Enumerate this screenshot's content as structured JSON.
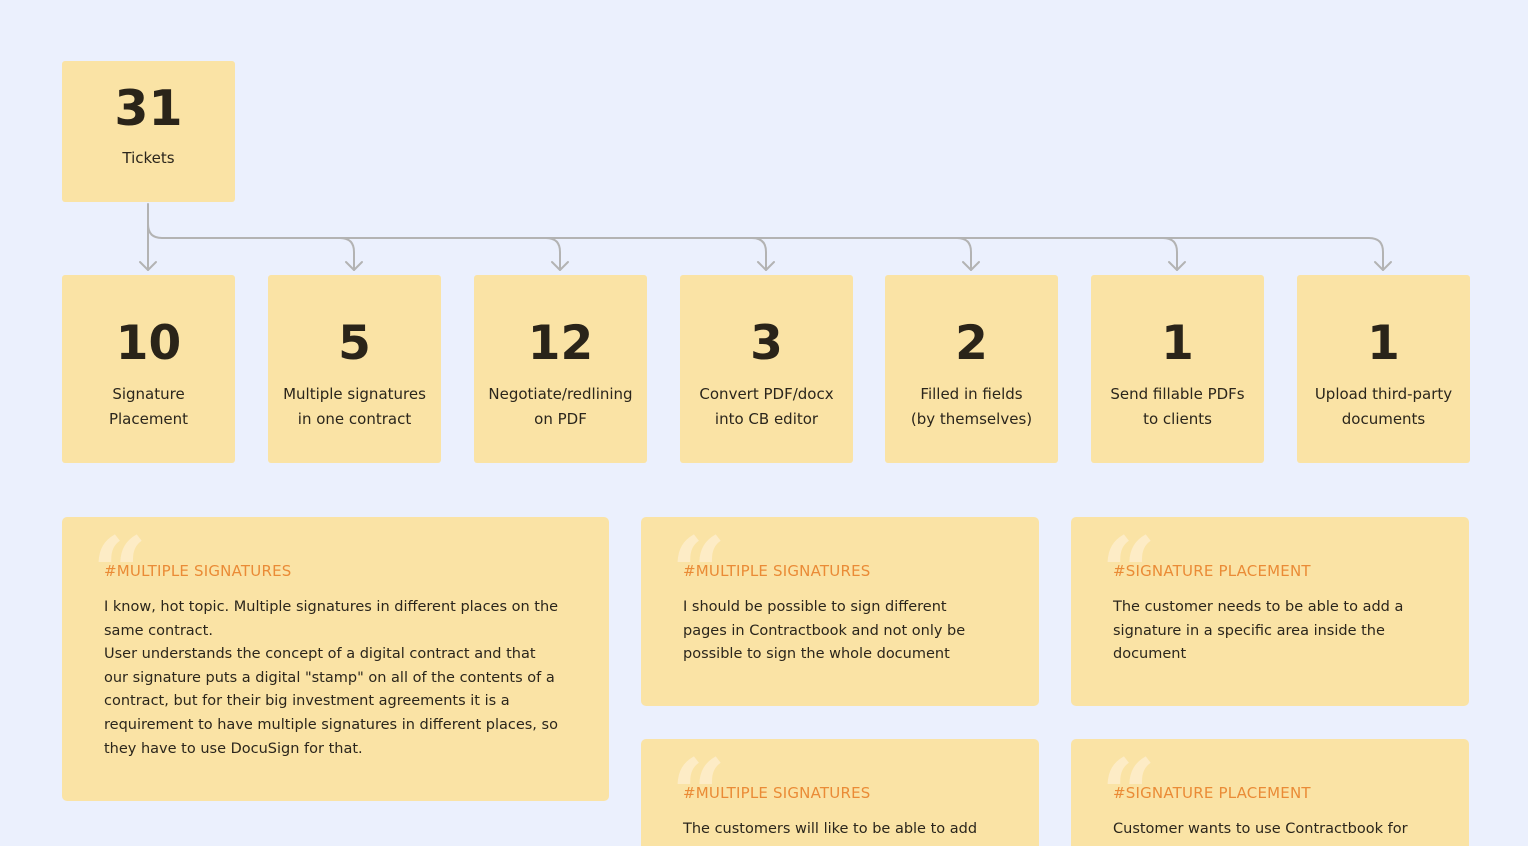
{
  "total": {
    "count": "31",
    "label": "Tickets"
  },
  "categories": [
    {
      "count": "10",
      "label_lines": [
        "Signature",
        "Placement"
      ]
    },
    {
      "count": "5",
      "label_lines": [
        "Multiple signatures",
        "in one contract"
      ]
    },
    {
      "count": "12",
      "label_lines": [
        "Negotiate/redlining",
        "on PDF"
      ]
    },
    {
      "count": "3",
      "label_lines": [
        "Convert PDF/docx",
        "into CB editor"
      ]
    },
    {
      "count": "2",
      "label_lines": [
        "Filled in fields",
        "(by themselves)"
      ]
    },
    {
      "count": "1",
      "label_lines": [
        "Send fillable PDFs",
        "to clients"
      ]
    },
    {
      "count": "1",
      "label_lines": [
        "Upload third-party",
        "documents"
      ]
    }
  ],
  "quotes": [
    {
      "tag": "#MULTIPLE SIGNATURES",
      "lines": [
        "I know, hot topic. Multiple signatures in different places on the",
        "same contract.",
        "User understands the concept of a digital contract and that",
        "our signature puts a digital \"stamp\" on all of the contents of a",
        "contract, but for their big investment agreements it is a",
        "requirement to have multiple signatures in different places, so",
        "they have to use DocuSign for that."
      ]
    },
    {
      "tag": "#MULTIPLE SIGNATURES",
      "lines": [
        "I should be possible to sign different",
        "pages in Contractbook and not only be",
        "possible to sign the whole document"
      ]
    },
    {
      "tag": "#SIGNATURE PLACEMENT",
      "lines": [
        "The customer needs to be able to add a",
        "signature in a specific area inside the",
        "document"
      ]
    },
    {
      "tag": "#MULTIPLE SIGNATURES",
      "lines": [
        "The customers will like to be able to add"
      ]
    },
    {
      "tag": "#SIGNATURE PLACEMENT",
      "lines": [
        "Customer wants to use Contractbook for"
      ]
    }
  ]
}
